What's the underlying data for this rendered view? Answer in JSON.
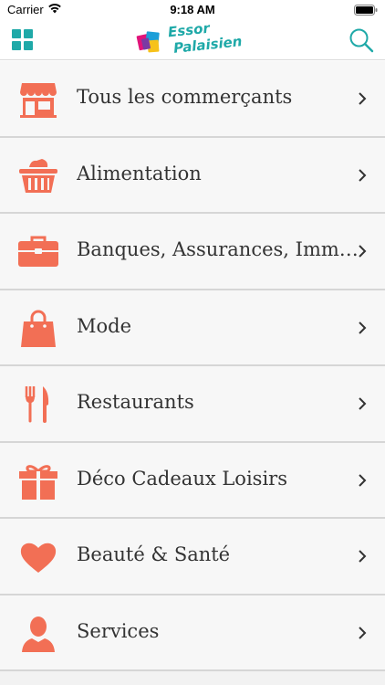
{
  "status_bar": {
    "carrier": "Carrier",
    "time": "9:18 AM"
  },
  "nav": {
    "logo_line1": "Essor",
    "logo_line2": "Palaisien",
    "menu_icon": "grid-icon",
    "search_icon": "search-icon"
  },
  "colors": {
    "accent": "#f26f55",
    "brand": "#1fa9a8",
    "text": "#333333",
    "row_bg": "#f7f7f7"
  },
  "categories": [
    {
      "label": "Tous les commerçants",
      "icon": "storefront-icon"
    },
    {
      "label": "Alimentation",
      "icon": "basket-icon"
    },
    {
      "label": "Banques, Assurances, Immobilier",
      "icon": "briefcase-icon"
    },
    {
      "label": "Mode",
      "icon": "shopping-bag-icon"
    },
    {
      "label": "Restaurants",
      "icon": "fork-knife-icon"
    },
    {
      "label": "Déco Cadeaux Loisirs",
      "icon": "gift-icon"
    },
    {
      "label": "Beauté & Santé",
      "icon": "heart-icon"
    },
    {
      "label": "Services",
      "icon": "person-icon"
    }
  ]
}
